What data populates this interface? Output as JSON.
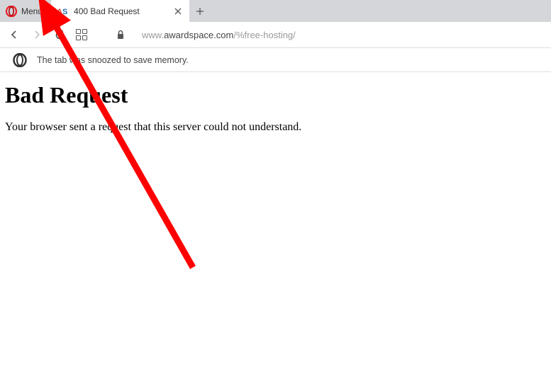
{
  "menu": {
    "label": "Menu"
  },
  "tab": {
    "favicon_text": "AS",
    "title": "400 Bad Request"
  },
  "url": {
    "prefix": "www.",
    "domain": "awardspace.com",
    "path": "/%free-hosting/"
  },
  "snooze": {
    "message": "The tab was snoozed to save memory."
  },
  "page": {
    "heading": "Bad Request",
    "body": "Your browser sent a request that this server could not understand."
  }
}
